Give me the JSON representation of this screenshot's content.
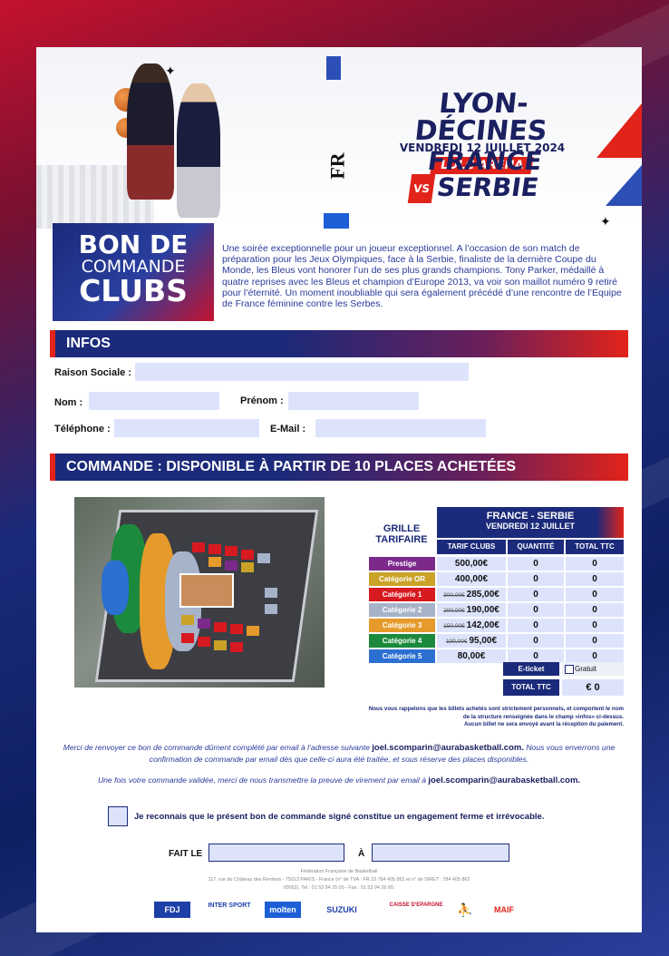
{
  "banner": {
    "city": "LYON-DÉCINES",
    "date": "VENDREDI 12 JUILLET 2024",
    "arena": "LDLC ARENA",
    "team_a": "FRANCE",
    "vs": "VS",
    "team_b": "SERBIE",
    "fr_mark": "FR"
  },
  "title": {
    "line1": "BON DE",
    "line2": "COMMANDE",
    "line3": "CLUBS"
  },
  "intro": "Une soirée exceptionnelle pour un joueur exceptionnel. A l’occasion de son match de préparation pour les Jeux Olympiques, face à la Serbie, finaliste de la dernière Coupe du Monde, les Bleus vont honorer l’un de ses plus grands champions. Tony Parker, médaillé à quatre reprises avec les Bleus et champion d’Europe 2013, va voir son maillot numéro 9 retiré pour l’éternité. Un moment inoubliable qui sera également précédé d’une rencontre de l’Equipe de France féminine contre les Serbes.",
  "infos": {
    "header": "INFOS",
    "raison_sociale": "Raison Sociale :",
    "nom": "Nom :",
    "prenom": "Prénom :",
    "telephone": "Téléphone :",
    "email": "E-Mail :"
  },
  "commande": {
    "header": "COMMANDE : DISPONIBLE À PARTIR DE 10 PLACES ACHETÉES"
  },
  "grille": {
    "line1": "GRILLE",
    "line2": "TARIFAIRE"
  },
  "price_table": {
    "match": "FRANCE - SERBIE",
    "date": "VENDREDI 12 JUILLET",
    "col_tarif": "TARIF CLUBS",
    "col_qte": "QUANTITÉ",
    "col_total": "TOTAL TTC",
    "rows": [
      {
        "cat": "Prestige",
        "color": "#7b2a8c",
        "old": "",
        "price": "500,00€",
        "qty": "0",
        "total": "0"
      },
      {
        "cat": "Catégorie OR",
        "color": "#c9a227",
        "old": "",
        "price": "400,00€",
        "qty": "0",
        "total": "0"
      },
      {
        "cat": "Catégorie 1",
        "color": "#d71920",
        "old": "300,00€",
        "price": "285,00€",
        "qty": "0",
        "total": "0"
      },
      {
        "cat": "Catégorie 2",
        "color": "#a7b3c9",
        "old": "200,00€",
        "price": "190,00€",
        "qty": "0",
        "total": "0"
      },
      {
        "cat": "Catégorie 3",
        "color": "#e59a2b",
        "old": "150,00€",
        "price": "142,00€",
        "qty": "0",
        "total": "0"
      },
      {
        "cat": "Catégorie 4",
        "color": "#1c8a3c",
        "old": "100,00€",
        "price": "95,00€",
        "qty": "0",
        "total": "0"
      },
      {
        "cat": "Catégorie 5",
        "color": "#2b6fd1",
        "old": "",
        "price": "80,00€",
        "qty": "0",
        "total": "0"
      }
    ],
    "eticket": "E-ticket",
    "gratuit": "Gratuit",
    "total_label": "TOTAL TTC",
    "total_value": "€ 0"
  },
  "disclaimer": {
    "l1": "Nous vous rappelons que les billets achetés sont strictement personnels, et comportent le nom",
    "l2": "de la structure renseignée dans le champ «infos» ci-dessus.",
    "l3": "Aucun billet ne sera envoyé avant la réception du paiement."
  },
  "note1": {
    "a": "Merci de renvoyer ce bon de commande dûment complété par email à l’adresse suivante ",
    "email": "joel.scomparin@aurabasketball.com.",
    "b": " Nous vous enverrons une confirmation de commande par email dès que celle-ci aura été traitée, et sous réserve des places disponibles."
  },
  "note2": {
    "a": "Une fois votre commande validée, merci de nous transmettre la preuve de virement par email à ",
    "email": "joel.scomparin@aurabasketball.com."
  },
  "checkbox_label": "Je reconnais que le présent bon de commande signé constitue un engagement ferme et irrévocable.",
  "sign": {
    "fait": "FAIT LE",
    "a": "À"
  },
  "footer": {
    "l1": "Fédération Française de Basketball",
    "l2": "117, rue du Château des Rentiers - 75013 PARIS - France (n° de TVA : FR 23 784 405 862 et n° de SIRET : 784 405 862",
    "l3": "00052). Tel : 01 53 94 25 00 - Fax : 01 53 94 26 80."
  },
  "sponsors": [
    "FDJ",
    "INTER SPORT",
    "molten",
    "SUZUKI",
    "CAISSE D'EPARGNE",
    "MAIF"
  ]
}
